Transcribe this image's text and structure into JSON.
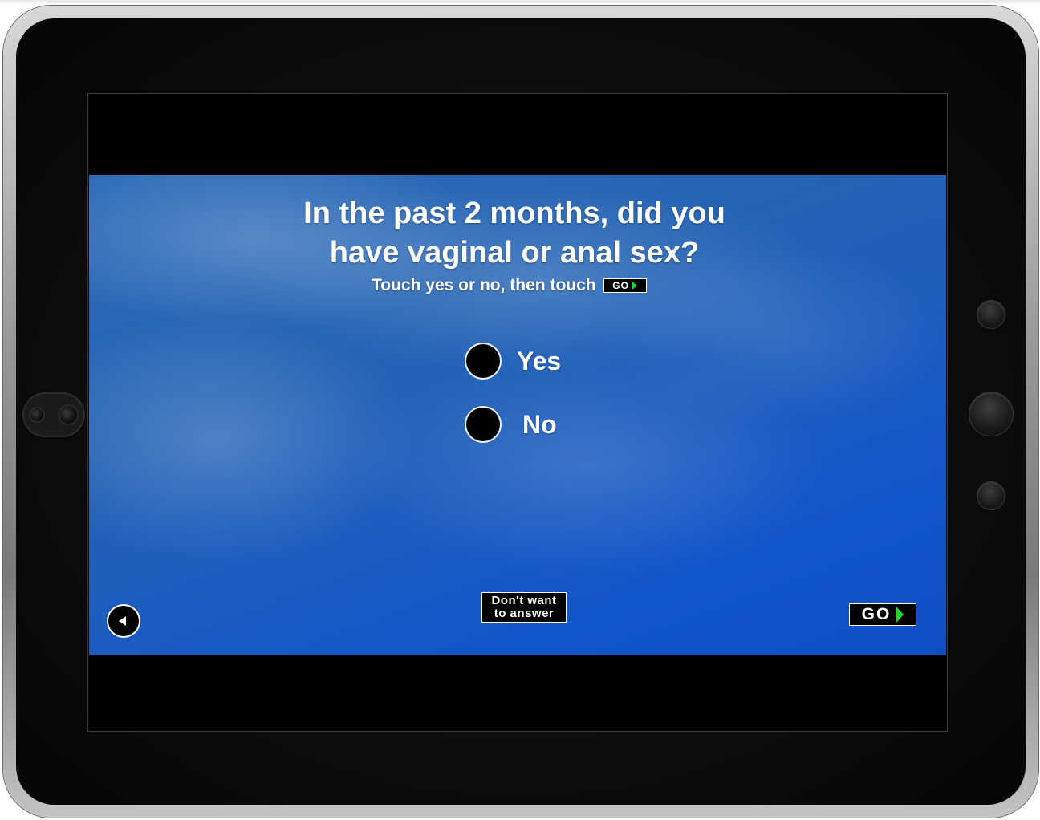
{
  "survey": {
    "question_line1": "In the past 2 months, did you",
    "question_line2": "have vaginal or anal sex?",
    "instruction": "Touch yes or no, then touch",
    "instruction_go": "GO",
    "options": [
      {
        "label": "Yes"
      },
      {
        "label": "No"
      }
    ],
    "dont_want_line1": "Don't want",
    "dont_want_line2": "to answer",
    "go_label": "GO"
  },
  "colors": {
    "background_blue": "#1b5cc0",
    "go_arrow_green": "#23d42b",
    "button_black": "#000000",
    "text_white": "#ffffff"
  },
  "icons": {
    "back": "back-arrow-icon",
    "go_arrow": "go-arrow-icon"
  }
}
